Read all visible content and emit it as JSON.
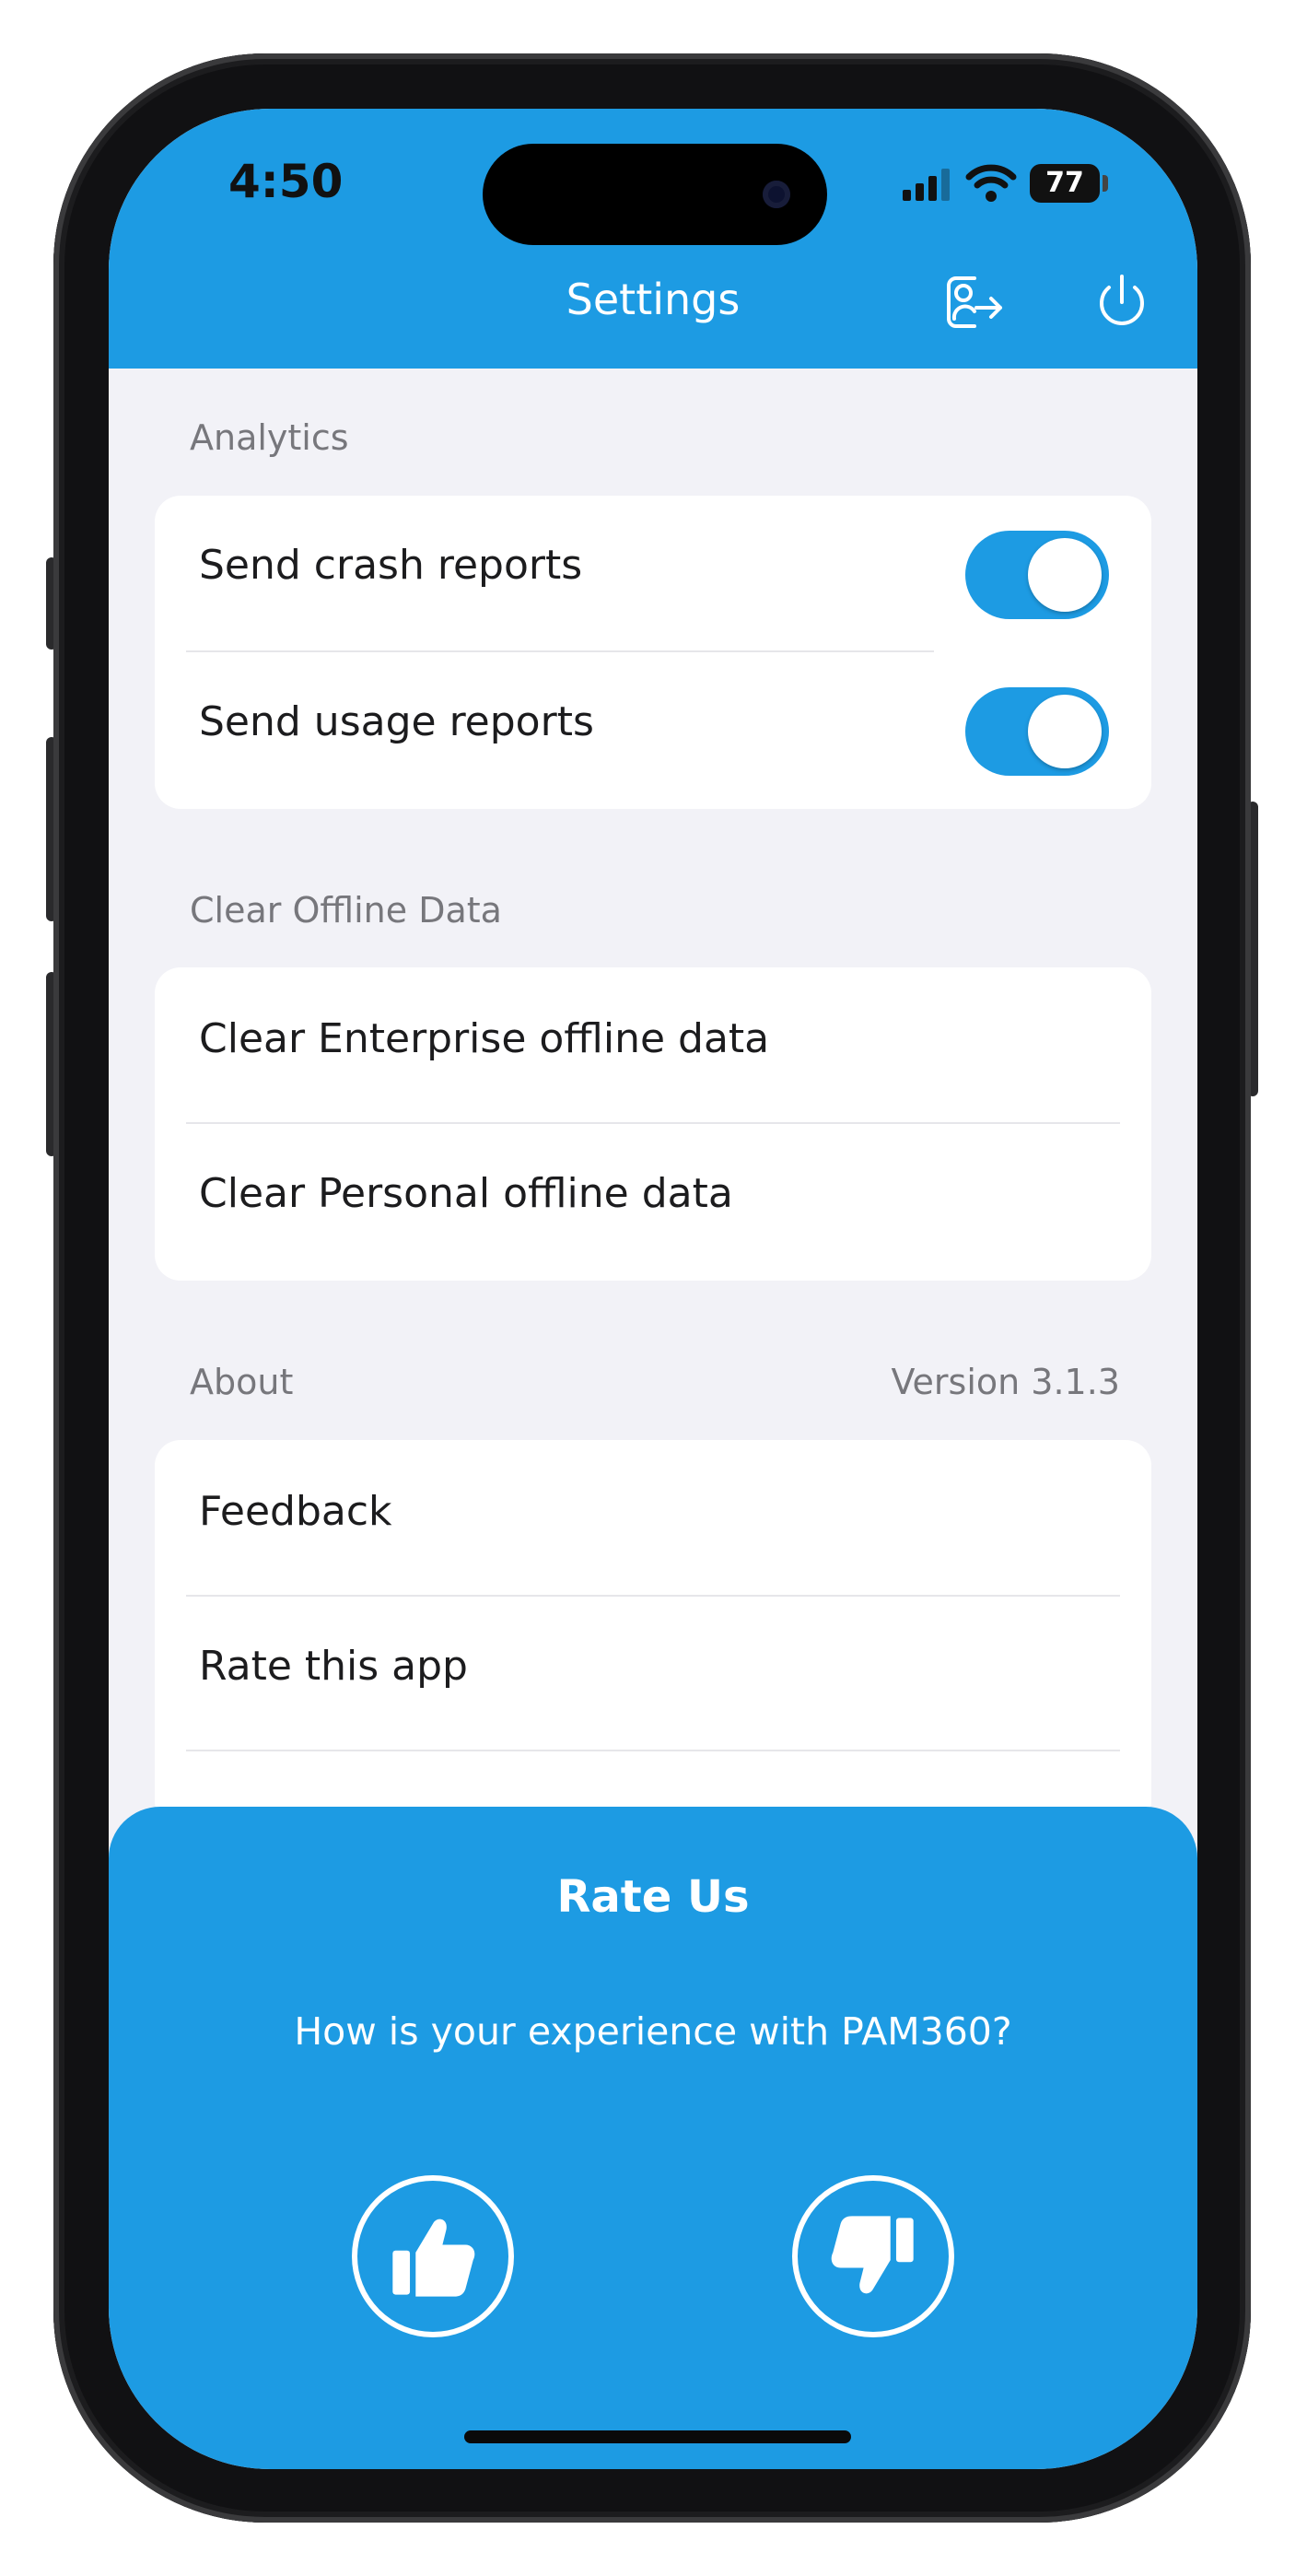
{
  "colors": {
    "accent": "#1d9be3",
    "background": "#f2f2f7",
    "card": "#ffffff"
  },
  "status_bar": {
    "time": "4:50",
    "battery": "77",
    "icons": [
      "signal-icon",
      "wifi-icon",
      "battery-icon"
    ]
  },
  "header": {
    "title": "Settings",
    "icons": [
      "switch-account-icon",
      "power-icon"
    ]
  },
  "analytics": {
    "label": "Analytics",
    "items": [
      {
        "label": "Send crash reports",
        "enabled": true
      },
      {
        "label": "Send usage reports",
        "enabled": true
      }
    ]
  },
  "offline": {
    "label": "Clear Offline Data",
    "items": [
      {
        "label": "Clear Enterprise offline data"
      },
      {
        "label": "Clear Personal offline data"
      }
    ]
  },
  "about": {
    "label": "About",
    "version": "Version 3.1.3",
    "items": [
      {
        "label": "Feedback"
      },
      {
        "label": "Rate this app"
      }
    ]
  },
  "rate_sheet": {
    "title": "Rate Us",
    "question": "How is your experience with PAM360?",
    "icons": [
      "thumbs-up-icon",
      "thumbs-down-icon"
    ]
  }
}
